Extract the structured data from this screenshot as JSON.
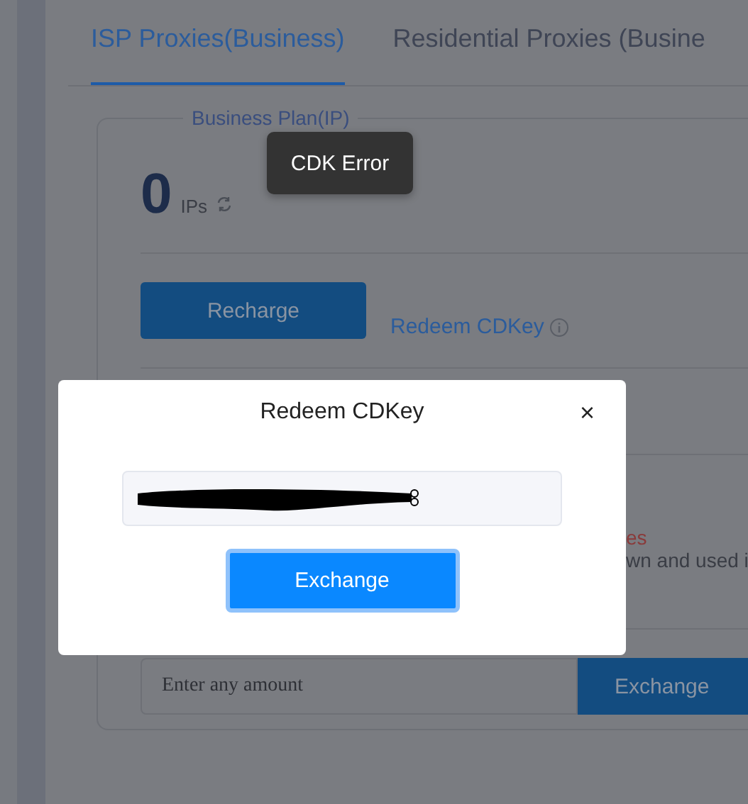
{
  "tabs": [
    {
      "label": "ISP Proxies(Business)",
      "selected": true
    },
    {
      "label": "Residential Proxies (Busine",
      "selected": false
    }
  ],
  "plan": {
    "legend": "Business Plan(IP)",
    "count": "0",
    "unit": "IPs",
    "recharge_button": "Recharge",
    "redeem_link": "Redeem CDKey",
    "notice_title": "es",
    "notice_text": "wn and used i",
    "amount_field": {
      "placeholder": "Enter any amount"
    },
    "exchange_button": "Exchange"
  },
  "tooltip": "CDK Error",
  "modal": {
    "title": "Redeem CDKey",
    "close": "×",
    "code_field": {
      "redacted": true
    },
    "exchange_button": "Exchange"
  }
}
